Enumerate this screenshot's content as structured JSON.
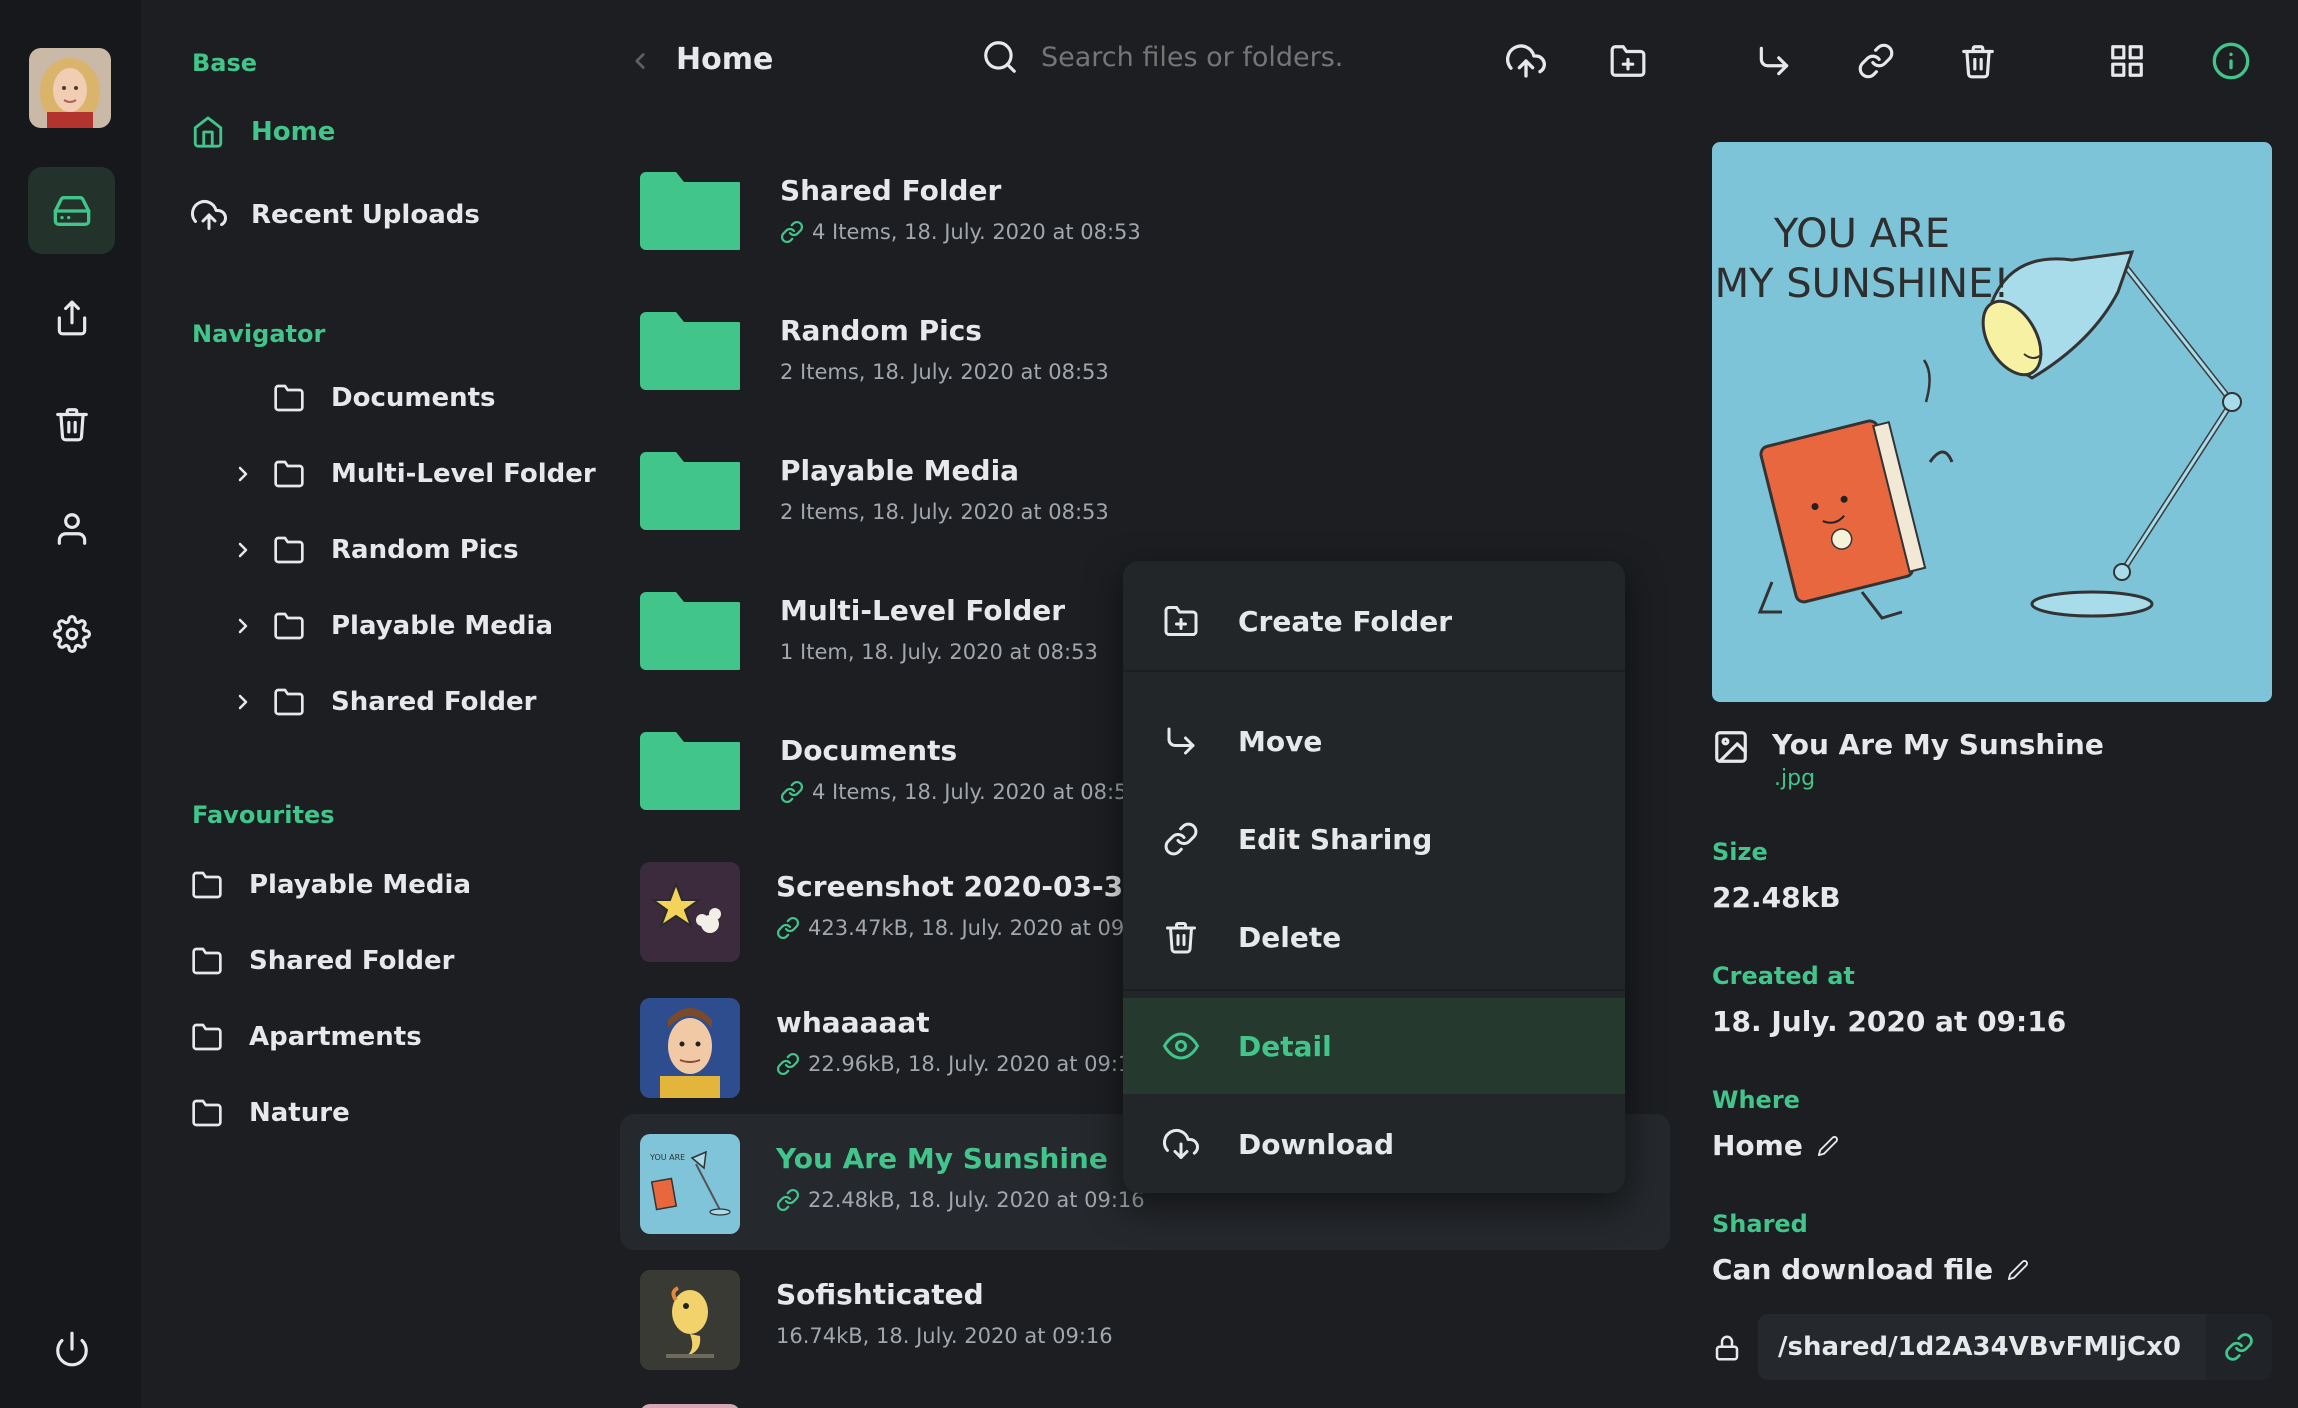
{
  "colors": {
    "accent": "#41c58a",
    "background": "#1c1e21",
    "rail": "#16181b",
    "folder": "#41c58a"
  },
  "rail": {
    "items": [
      {
        "icon": "hard-drive-icon",
        "active": true
      },
      {
        "icon": "upload-icon",
        "active": false
      },
      {
        "icon": "trash-icon",
        "active": false
      },
      {
        "icon": "user-icon",
        "active": false
      },
      {
        "icon": "gear-icon",
        "active": false
      }
    ],
    "bottom_icon": "power-icon"
  },
  "sidebar": {
    "base_title": "Base",
    "base_items": [
      {
        "label": "Home",
        "icon": "home-icon",
        "active": true
      },
      {
        "label": "Recent Uploads",
        "icon": "cloud-upload-icon",
        "active": false
      }
    ],
    "navigator_title": "Navigator",
    "navigator_items": [
      {
        "label": "Documents",
        "expandable": false
      },
      {
        "label": "Multi-Level Folder",
        "expandable": true
      },
      {
        "label": "Random Pics",
        "expandable": true
      },
      {
        "label": "Playable Media",
        "expandable": true
      },
      {
        "label": "Shared Folder",
        "expandable": true
      }
    ],
    "favourites_title": "Favourites",
    "favourites_items": [
      {
        "label": "Playable Media"
      },
      {
        "label": "Shared Folder"
      },
      {
        "label": "Apartments"
      },
      {
        "label": "Nature"
      }
    ]
  },
  "toolbar": {
    "title": "Home",
    "search_placeholder": "Search files or folders...",
    "actions": [
      "upload-icon",
      "create-folder-icon",
      "move-icon",
      "share-link-icon",
      "trash-icon",
      "grid-view-icon",
      "info-icon"
    ]
  },
  "files": [
    {
      "name": "Shared Folder",
      "meta": "4 Items, 18. July. 2020 at 08:53",
      "type": "folder",
      "shared": true,
      "selected": false
    },
    {
      "name": "Random Pics",
      "meta": "2 Items, 18. July. 2020 at 08:53",
      "type": "folder",
      "shared": false,
      "selected": false
    },
    {
      "name": "Playable Media",
      "meta": "2 Items, 18. July. 2020 at 08:53",
      "type": "folder",
      "shared": false,
      "selected": false
    },
    {
      "name": "Multi-Level Folder",
      "meta": "1 Item, 18. July. 2020 at 08:53",
      "type": "folder",
      "shared": false,
      "selected": false
    },
    {
      "name": "Documents",
      "meta": "4 Items, 18. July. 2020 at 08:53",
      "type": "folder",
      "shared": true,
      "selected": false
    },
    {
      "name": "Screenshot 2020-03-30 at",
      "meta": "423.47kB, 18. July. 2020 at 09:1",
      "type": "image",
      "thumb": "star",
      "shared": true,
      "selected": false
    },
    {
      "name": "whaaaaat",
      "meta": "22.96kB, 18. July. 2020 at 09:16",
      "type": "image",
      "thumb": "portrait",
      "shared": true,
      "selected": false
    },
    {
      "name": "You Are My Sunshine",
      "meta": "22.48kB, 18. July. 2020 at 09:16",
      "type": "image",
      "thumb": "sunshine",
      "shared": true,
      "selected": true
    },
    {
      "name": "Sofishticated",
      "meta": "16.74kB, 18. July. 2020 at 09:16",
      "type": "image",
      "thumb": "fish",
      "shared": false,
      "selected": false
    }
  ],
  "context_menu": {
    "items": [
      {
        "label": "Create Folder",
        "icon": "create-folder-icon",
        "active": false
      },
      {
        "label": "Move",
        "icon": "move-icon",
        "active": false
      },
      {
        "label": "Edit Sharing",
        "icon": "share-link-icon",
        "active": false
      },
      {
        "label": "Delete",
        "icon": "trash-icon",
        "active": false
      },
      {
        "label": "Detail",
        "icon": "eye-icon",
        "active": true
      },
      {
        "label": "Download",
        "icon": "download-icon",
        "active": false
      }
    ]
  },
  "detail": {
    "preview_text": [
      "YOU ARE",
      "MY SUNSHINE!"
    ],
    "file_name": "You Are My Sunshine",
    "file_ext": ".jpg",
    "size_label": "Size",
    "size_value": "22.48kB",
    "created_label": "Created at",
    "created_value": "18. July. 2020 at 09:16",
    "where_label": "Where",
    "where_value": "Home",
    "shared_label": "Shared",
    "shared_value": "Can download file",
    "share_link": "/shared/1d2A34VBvFMljCx0"
  }
}
